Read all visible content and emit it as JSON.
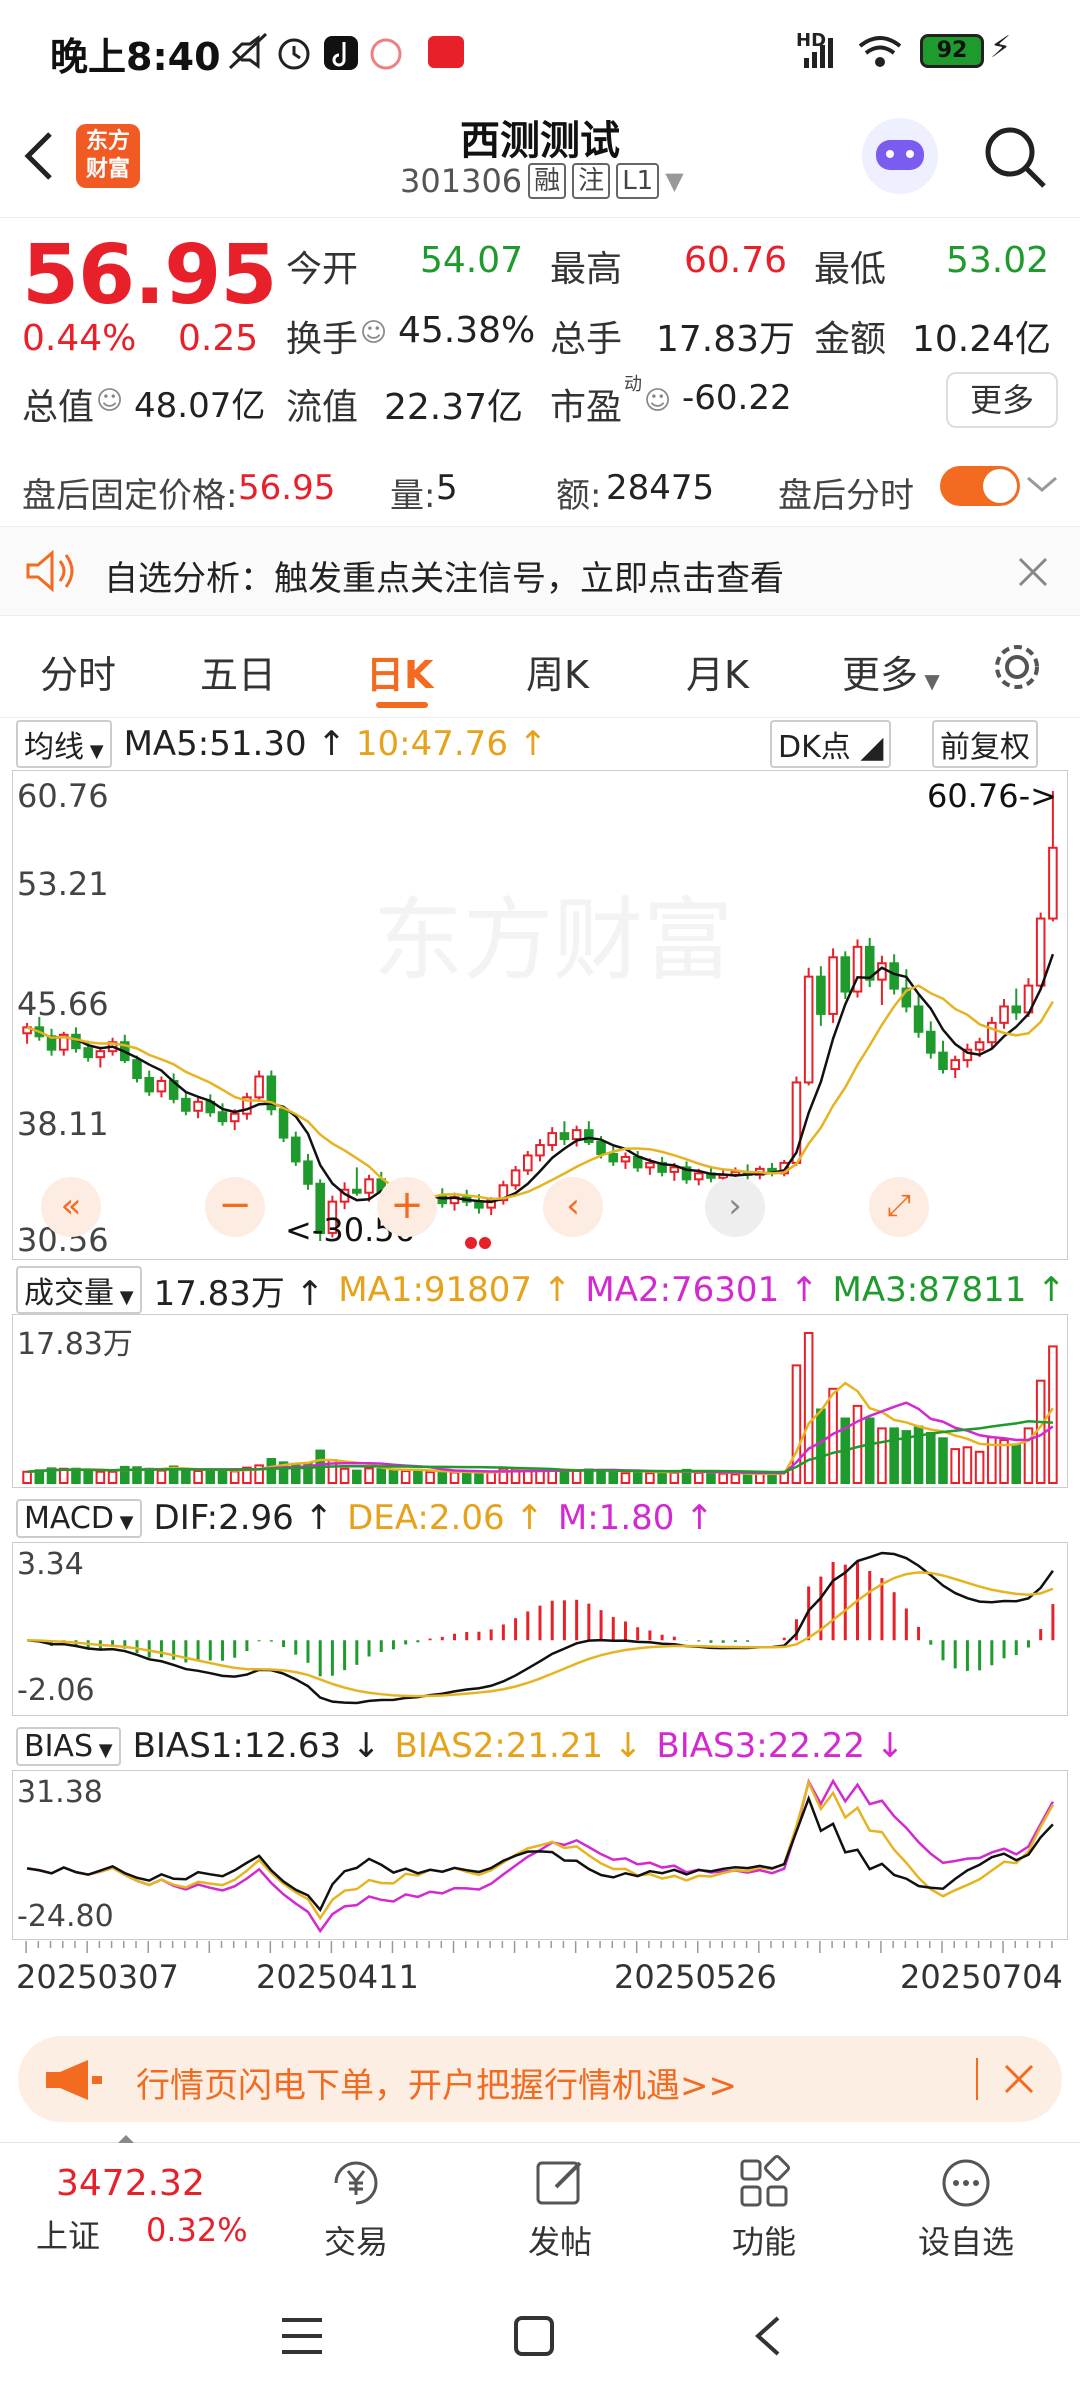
{
  "status": {
    "time": "晚上8:40",
    "battery": "92",
    "net": "HD"
  },
  "header": {
    "logo_text_1": "东方",
    "logo_text_2": "财富",
    "title": "西测测试",
    "code": "301306",
    "tag1": "融",
    "tag2": "注",
    "tag3": "L1"
  },
  "quote": {
    "price": "56.95",
    "change_pct": "0.44%",
    "change": "0.25",
    "open_label": "今开",
    "open": "54.07",
    "high_label": "最高",
    "high": "60.76",
    "low_label": "最低",
    "low": "53.02",
    "turnover_label": "换手",
    "turnover": "45.38%",
    "volume_label": "总手",
    "volume": "17.83万",
    "amount_label": "金额",
    "amount": "10.24亿",
    "mktcap_label": "总值",
    "mktcap": "48.07亿",
    "float_label": "流值",
    "float": "22.37亿",
    "pe_label": "市盈",
    "pe_sup": "动",
    "pe": "-60.22",
    "more_label": "更多"
  },
  "after_hours": {
    "price_label": "盘后固定价格:",
    "price": "56.95",
    "vol_label": "量:",
    "vol": "5",
    "amt_label": "额:",
    "amt": "28475",
    "toggle_label": "盘后分时"
  },
  "notice": {
    "text": "自选分析：触发重点关注信号，立即点击查看"
  },
  "tabs": [
    "分时",
    "五日",
    "日K",
    "周K",
    "月K",
    "更多"
  ],
  "ma_row": {
    "selector": "均线",
    "ma5": "MA5:51.30",
    "ma10": "10:47.76",
    "dk": "DK点",
    "fq": "前复权"
  },
  "kline_axis": {
    "top": "60.76",
    "l2": "53.21",
    "l3": "45.66",
    "l4": "38.11",
    "bottom": "30.56",
    "max_marker": "60.76->",
    "min_marker": "<-30.56"
  },
  "vol_row": {
    "selector": "成交量",
    "value": "17.83万",
    "ma1": "MA1:91807",
    "ma2": "MA2:76301",
    "ma3": "MA3:87811",
    "axis_top": "17.83万"
  },
  "macd_row": {
    "selector": "MACD",
    "dif": "DIF:2.96",
    "dea": "DEA:2.06",
    "m": "M:1.80",
    "axis_top": "3.34",
    "axis_bottom": "-2.06"
  },
  "bias_row": {
    "selector": "BIAS",
    "b1": "BIAS1:12.63",
    "b2": "BIAS2:21.21",
    "b3": "BIAS3:22.22",
    "axis_top": "31.38",
    "axis_bottom": "-24.80"
  },
  "dates": [
    "20250307",
    "20250411",
    "20250526",
    "20250704"
  ],
  "ad": {
    "text": "行情页闪电下单，开户把握行情机遇>>"
  },
  "bottom_bar": {
    "index_value": "3472.32",
    "index_name": "上证",
    "index_pct": "0.32%",
    "items": [
      "交易",
      "发帖",
      "功能",
      "设自选"
    ]
  },
  "chart_data": {
    "type": "candlestick",
    "title": "",
    "ylim": [
      30.56,
      60.76
    ],
    "ohlc": [
      [
        44.5,
        45.2,
        43.8,
        44.9
      ],
      [
        44.9,
        45.6,
        44.0,
        44.3
      ],
      [
        44.3,
        44.8,
        43.0,
        43.4
      ],
      [
        43.4,
        44.6,
        43.0,
        44.4
      ],
      [
        44.4,
        44.9,
        43.2,
        43.5
      ],
      [
        43.5,
        44.0,
        42.6,
        42.9
      ],
      [
        42.9,
        43.6,
        42.2,
        43.3
      ],
      [
        43.3,
        44.2,
        43.0,
        43.9
      ],
      [
        43.9,
        44.4,
        42.5,
        42.7
      ],
      [
        42.7,
        43.0,
        41.2,
        41.5
      ],
      [
        41.5,
        42.0,
        40.3,
        40.6
      ],
      [
        40.6,
        41.6,
        40.2,
        41.3
      ],
      [
        41.3,
        41.8,
        39.8,
        40.1
      ],
      [
        40.1,
        40.6,
        39.0,
        39.3
      ],
      [
        39.3,
        40.2,
        38.8,
        39.9
      ],
      [
        39.9,
        40.4,
        38.9,
        39.2
      ],
      [
        39.2,
        39.8,
        38.3,
        38.6
      ],
      [
        38.6,
        39.4,
        38.0,
        39.1
      ],
      [
        39.1,
        40.5,
        38.7,
        40.2
      ],
      [
        40.2,
        42.0,
        39.9,
        41.6
      ],
      [
        41.6,
        42.0,
        39.0,
        39.4
      ],
      [
        39.4,
        39.6,
        37.2,
        37.5
      ],
      [
        37.5,
        37.9,
        35.6,
        35.9
      ],
      [
        35.9,
        36.4,
        34.0,
        34.4
      ],
      [
        34.4,
        34.7,
        30.56,
        31.1
      ],
      [
        31.1,
        33.6,
        30.8,
        33.2
      ],
      [
        33.2,
        34.5,
        32.7,
        34.0
      ],
      [
        34.0,
        35.5,
        33.6,
        33.8
      ],
      [
        33.8,
        35.0,
        33.2,
        34.7
      ],
      [
        34.7,
        35.2,
        33.5,
        33.9
      ],
      [
        33.9,
        34.6,
        32.9,
        33.3
      ],
      [
        33.3,
        34.2,
        32.8,
        33.9
      ],
      [
        33.9,
        34.4,
        33.0,
        33.2
      ],
      [
        33.2,
        33.9,
        32.6,
        33.6
      ],
      [
        33.6,
        34.1,
        32.8,
        33.1
      ],
      [
        33.1,
        33.8,
        32.6,
        33.5
      ],
      [
        33.5,
        34.0,
        32.9,
        33.2
      ],
      [
        33.2,
        33.7,
        32.4,
        32.8
      ],
      [
        32.8,
        33.5,
        32.3,
        33.3
      ],
      [
        33.3,
        34.6,
        33.0,
        34.3
      ],
      [
        34.3,
        35.6,
        34.0,
        35.3
      ],
      [
        35.3,
        36.6,
        35.0,
        36.3
      ],
      [
        36.3,
        37.4,
        35.9,
        37.0
      ],
      [
        37.0,
        38.2,
        36.6,
        37.8
      ],
      [
        37.8,
        38.6,
        37.0,
        37.4
      ],
      [
        37.4,
        38.3,
        36.9,
        38.0
      ],
      [
        38.0,
        38.6,
        37.0,
        37.2
      ],
      [
        37.2,
        37.6,
        36.1,
        36.4
      ],
      [
        36.4,
        36.9,
        35.6,
        35.9
      ],
      [
        35.9,
        36.5,
        35.4,
        36.2
      ],
      [
        36.2,
        36.6,
        35.2,
        35.5
      ],
      [
        35.5,
        36.1,
        35.0,
        35.8
      ],
      [
        35.8,
        36.2,
        34.9,
        35.2
      ],
      [
        35.2,
        35.8,
        34.6,
        35.5
      ],
      [
        35.5,
        35.9,
        34.4,
        34.7
      ],
      [
        34.7,
        35.4,
        34.3,
        35.1
      ],
      [
        35.1,
        35.6,
        34.5,
        34.8
      ],
      [
        34.8,
        35.3,
        34.2,
        35.0
      ],
      [
        35.0,
        35.5,
        34.6,
        35.2
      ],
      [
        35.2,
        35.7,
        34.7,
        35.0
      ],
      [
        35.0,
        35.6,
        34.7,
        35.4
      ],
      [
        35.4,
        35.8,
        34.9,
        35.1
      ],
      [
        35.1,
        36.0,
        34.9,
        35.8
      ],
      [
        35.8,
        41.6,
        35.6,
        41.2
      ],
      [
        41.2,
        48.9,
        41.0,
        48.3
      ],
      [
        48.3,
        49.0,
        45.0,
        45.8
      ],
      [
        45.8,
        50.2,
        45.2,
        49.6
      ],
      [
        49.6,
        50.0,
        46.8,
        47.3
      ],
      [
        47.3,
        50.8,
        46.9,
        50.3
      ],
      [
        50.3,
        50.9,
        47.6,
        48.1
      ],
      [
        48.1,
        49.7,
        46.4,
        49.2
      ],
      [
        49.2,
        49.8,
        47.1,
        47.5
      ],
      [
        47.5,
        48.8,
        45.9,
        46.3
      ],
      [
        46.3,
        47.1,
        44.2,
        44.6
      ],
      [
        44.6,
        45.3,
        42.8,
        43.2
      ],
      [
        43.2,
        44.0,
        41.8,
        42.1
      ],
      [
        42.1,
        43.0,
        41.5,
        42.7
      ],
      [
        42.7,
        43.8,
        42.2,
        43.4
      ],
      [
        43.4,
        44.2,
        42.9,
        43.9
      ],
      [
        43.9,
        45.6,
        43.5,
        45.2
      ],
      [
        45.2,
        46.8,
        44.8,
        46.3
      ],
      [
        46.3,
        47.5,
        45.4,
        45.9
      ],
      [
        45.9,
        48.2,
        45.6,
        47.7
      ],
      [
        47.7,
        52.6,
        47.4,
        52.2
      ],
      [
        52.2,
        60.76,
        52.0,
        56.95
      ]
    ]
  }
}
